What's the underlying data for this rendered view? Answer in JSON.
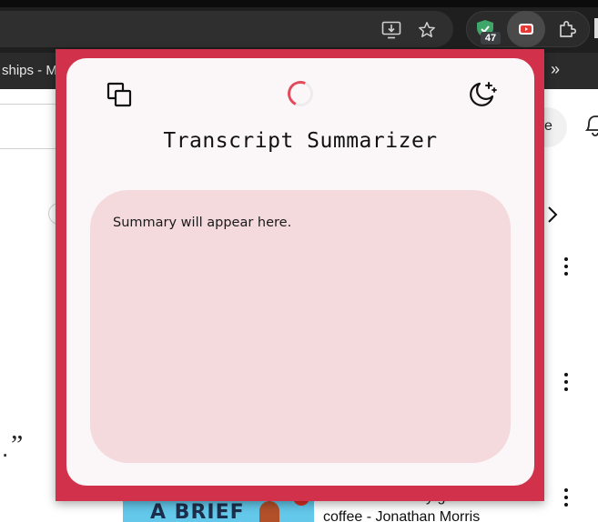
{
  "browser": {
    "bookmark_text": "ships - Ma",
    "overflow_label": "»",
    "extension_badge": "47"
  },
  "background_page": {
    "pill_letter": "e",
    "quote_mark": "„",
    "period_mark": ".",
    "thumbnail_text": "A BRIEF",
    "video_title_line1": "y g",
    "video_title_line2": "coffee - Jonathan Morris"
  },
  "popup": {
    "title": "Transcript Summarizer",
    "summary_placeholder": "Summary will appear here.",
    "icons": {
      "copy": "copy-icon",
      "theme": "moon-stars-icon",
      "loading": "loading-spinner"
    },
    "colors": {
      "frame": "#d1314a",
      "card": "#fbf7f8",
      "summary_bg": "#f4d9dd",
      "spinner_accent": "#e34a5c"
    }
  }
}
